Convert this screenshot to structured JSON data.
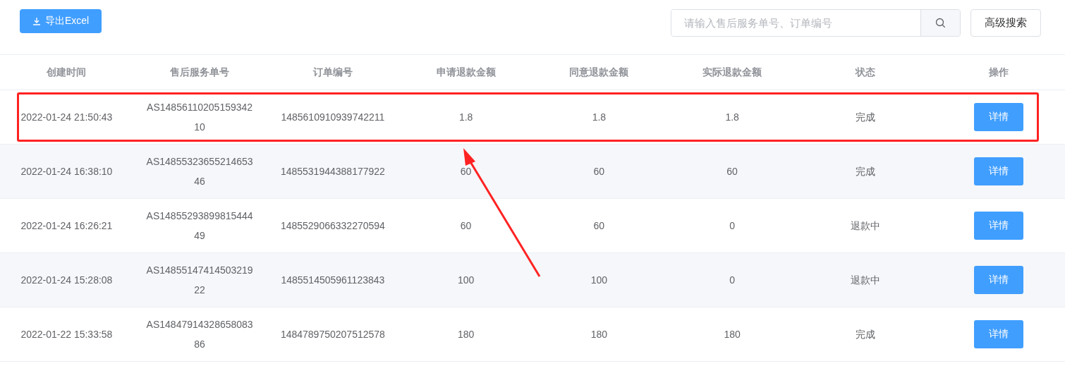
{
  "toolbar": {
    "export_button": "导出Excel",
    "search": {
      "placeholder": "请输入售后服务单号、订单编号"
    },
    "advanced_button": "高级搜索"
  },
  "table": {
    "columns": [
      "创建时间",
      "售后服务单号",
      "订单编号",
      "申请退款金额",
      "同意退款金额",
      "实际退款金额",
      "状态",
      "操作"
    ],
    "rows": [
      {
        "created": "2022-01-24 21:50:43",
        "service_no": "AS1485611020515934210",
        "order_no": "1485610910939742211",
        "requested": "1.8",
        "agreed": "1.8",
        "actual": "1.8",
        "status": "完成",
        "action": "详情",
        "highlighted": true
      },
      {
        "created": "2022-01-24 16:38:10",
        "service_no": "AS1485532365521465346",
        "order_no": "1485531944388177922",
        "requested": "60",
        "agreed": "60",
        "actual": "60",
        "status": "完成",
        "action": "详情",
        "highlighted": false
      },
      {
        "created": "2022-01-24 16:26:21",
        "service_no": "AS1485529389981544449",
        "order_no": "1485529066332270594",
        "requested": "60",
        "agreed": "60",
        "actual": "0",
        "status": "退款中",
        "action": "详情",
        "highlighted": false
      },
      {
        "created": "2022-01-24 15:28:08",
        "service_no": "AS1485514741450321922",
        "order_no": "1485514505961123843",
        "requested": "100",
        "agreed": "100",
        "actual": "0",
        "status": "退款中",
        "action": "详情",
        "highlighted": false
      },
      {
        "created": "2022-01-22 15:33:58",
        "service_no": "AS1484791432865808386",
        "order_no": "1484789750207512578",
        "requested": "180",
        "agreed": "180",
        "actual": "180",
        "status": "完成",
        "action": "详情",
        "highlighted": false
      }
    ]
  }
}
